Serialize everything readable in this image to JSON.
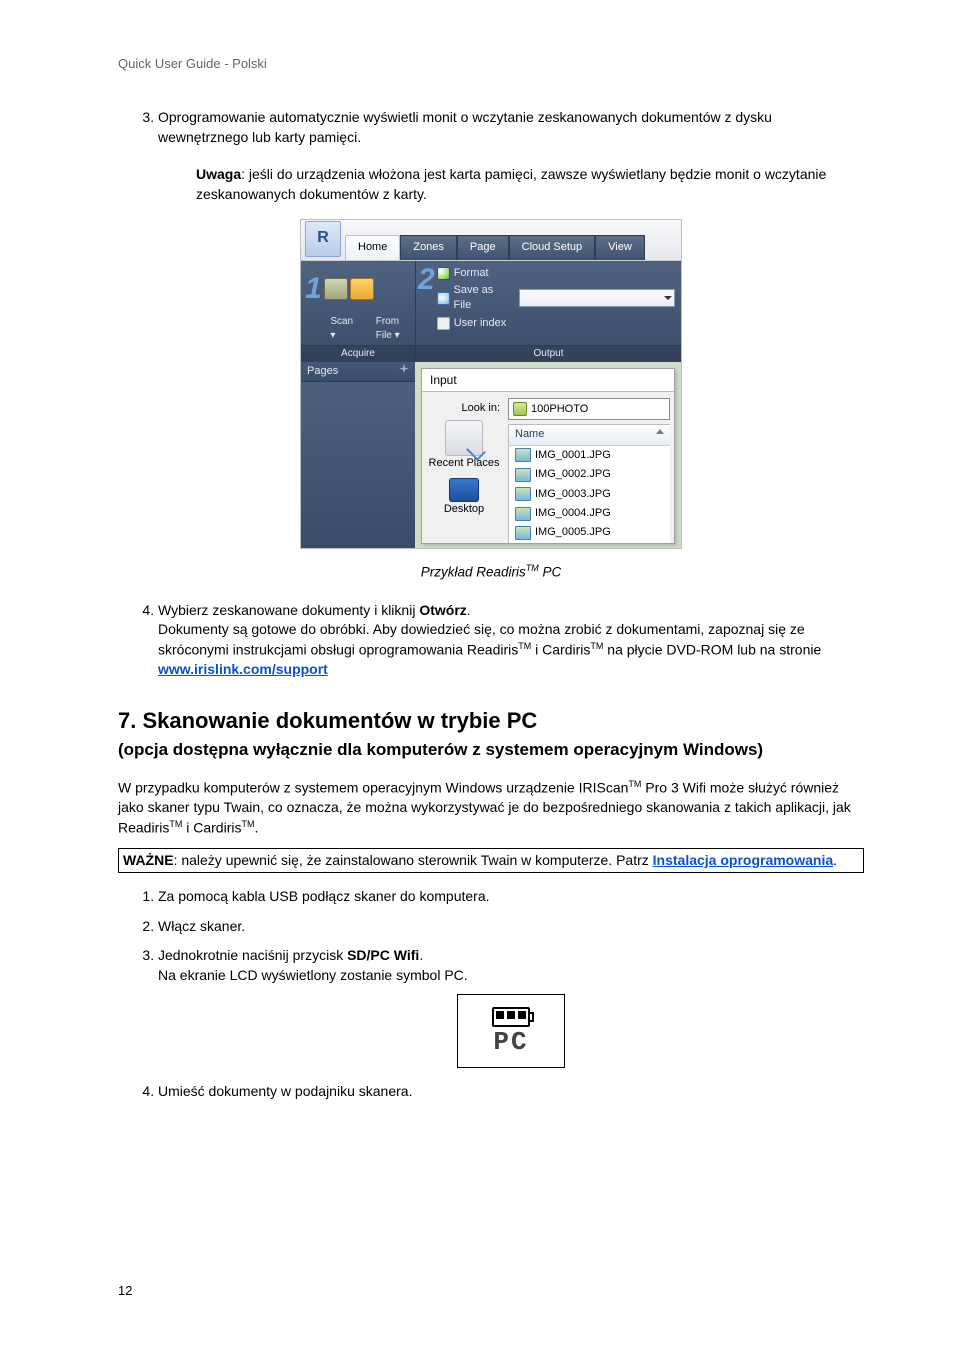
{
  "header": "Quick User Guide - Polski",
  "list_a": {
    "start": 3,
    "item3_line1": "Oprogramowanie automatycznie wyświetli monit o wczytanie zeskanowanych dokumentów z dysku wewnętrznego lub karty pamięci.",
    "note_bold": "Uwaga",
    "note_text": ": jeśli do urządzenia włożona jest karta pamięci, zawsze wyświetlany będzie monit o wczytanie zeskanowanych dokumentów z karty."
  },
  "screenshot": {
    "tabs": {
      "home": "Home",
      "zones": "Zones",
      "page": "Page",
      "cloud": "Cloud Setup",
      "view": "View"
    },
    "ribbon": {
      "num1": "1",
      "num2": "2",
      "scan": "Scan",
      "from": "From",
      "file": "File",
      "acquire": "Acquire",
      "format": "Format",
      "saveas": "Save as File",
      "userindex": "User index",
      "output": "Output"
    },
    "pages_panel": "Pages",
    "dialog": {
      "title": "Input",
      "lookin_label": "Look in:",
      "lookin_value": "100PHOTO",
      "recent": "Recent Places",
      "desktop": "Desktop",
      "col_name": "Name",
      "files": [
        "IMG_0001.JPG",
        "IMG_0002.JPG",
        "IMG_0003.JPG",
        "IMG_0004.JPG",
        "IMG_0005.JPG"
      ]
    }
  },
  "caption_prefix": "Przykład Readiris",
  "caption_suffix": " PC",
  "list_b": {
    "item4_line1_prefix": "Wybierz zeskanowane dokumenty i kliknij ",
    "item4_line1_bold": "Otwórz",
    "item4_line1_suffix": ".",
    "item4_para": "Dokumenty są gotowe do obróbki. Aby dowiedzieć się, co można zrobić z dokumentami, zapoznaj się ze skróconymi instrukcjami obsługi oprogramowania Readiris",
    "item4_para2": " i Cardiris",
    "item4_para3": " na płycie DVD-ROM lub na stronie",
    "link1": "www.irislink.com/support"
  },
  "section7": {
    "title": "7. Skanowanie dokumentów w trybie PC",
    "subtitle": "(opcja dostępna wyłącznie dla komputerów z systemem operacyjnym Windows)",
    "p1_a": "W przypadku komputerów z systemem operacyjnym Windows urządzenie IRIScan",
    "p1_b": " Pro 3 Wifi może służyć również jako skaner typu Twain, co oznacza, że można wykorzystywać je do bezpośredniego skanowania z takich aplikacji, jak Readiris",
    "p1_c": " i Cardiris",
    "p1_d": ".",
    "imp_bold": "WAŻNE",
    "imp_text": ": należy upewnić się, że zainstalowano sterownik Twain w komputerze. Patrz ",
    "imp_link": "Instalacja oprogramowania",
    "imp_dot": "."
  },
  "list_c": {
    "i1": "Za pomocą kabla USB podłącz skaner do komputera.",
    "i2": "Włącz skaner.",
    "i3a": "Jednokrotnie naciśnij przycisk ",
    "i3b": "SD/PC Wifi",
    "i3c": ".",
    "i3d": "Na ekranie LCD wyświetlony zostanie symbol PC.",
    "i4": "Umieść dokumenty w podajniku skanera."
  },
  "lcd_text": "PC",
  "page_number": "12"
}
